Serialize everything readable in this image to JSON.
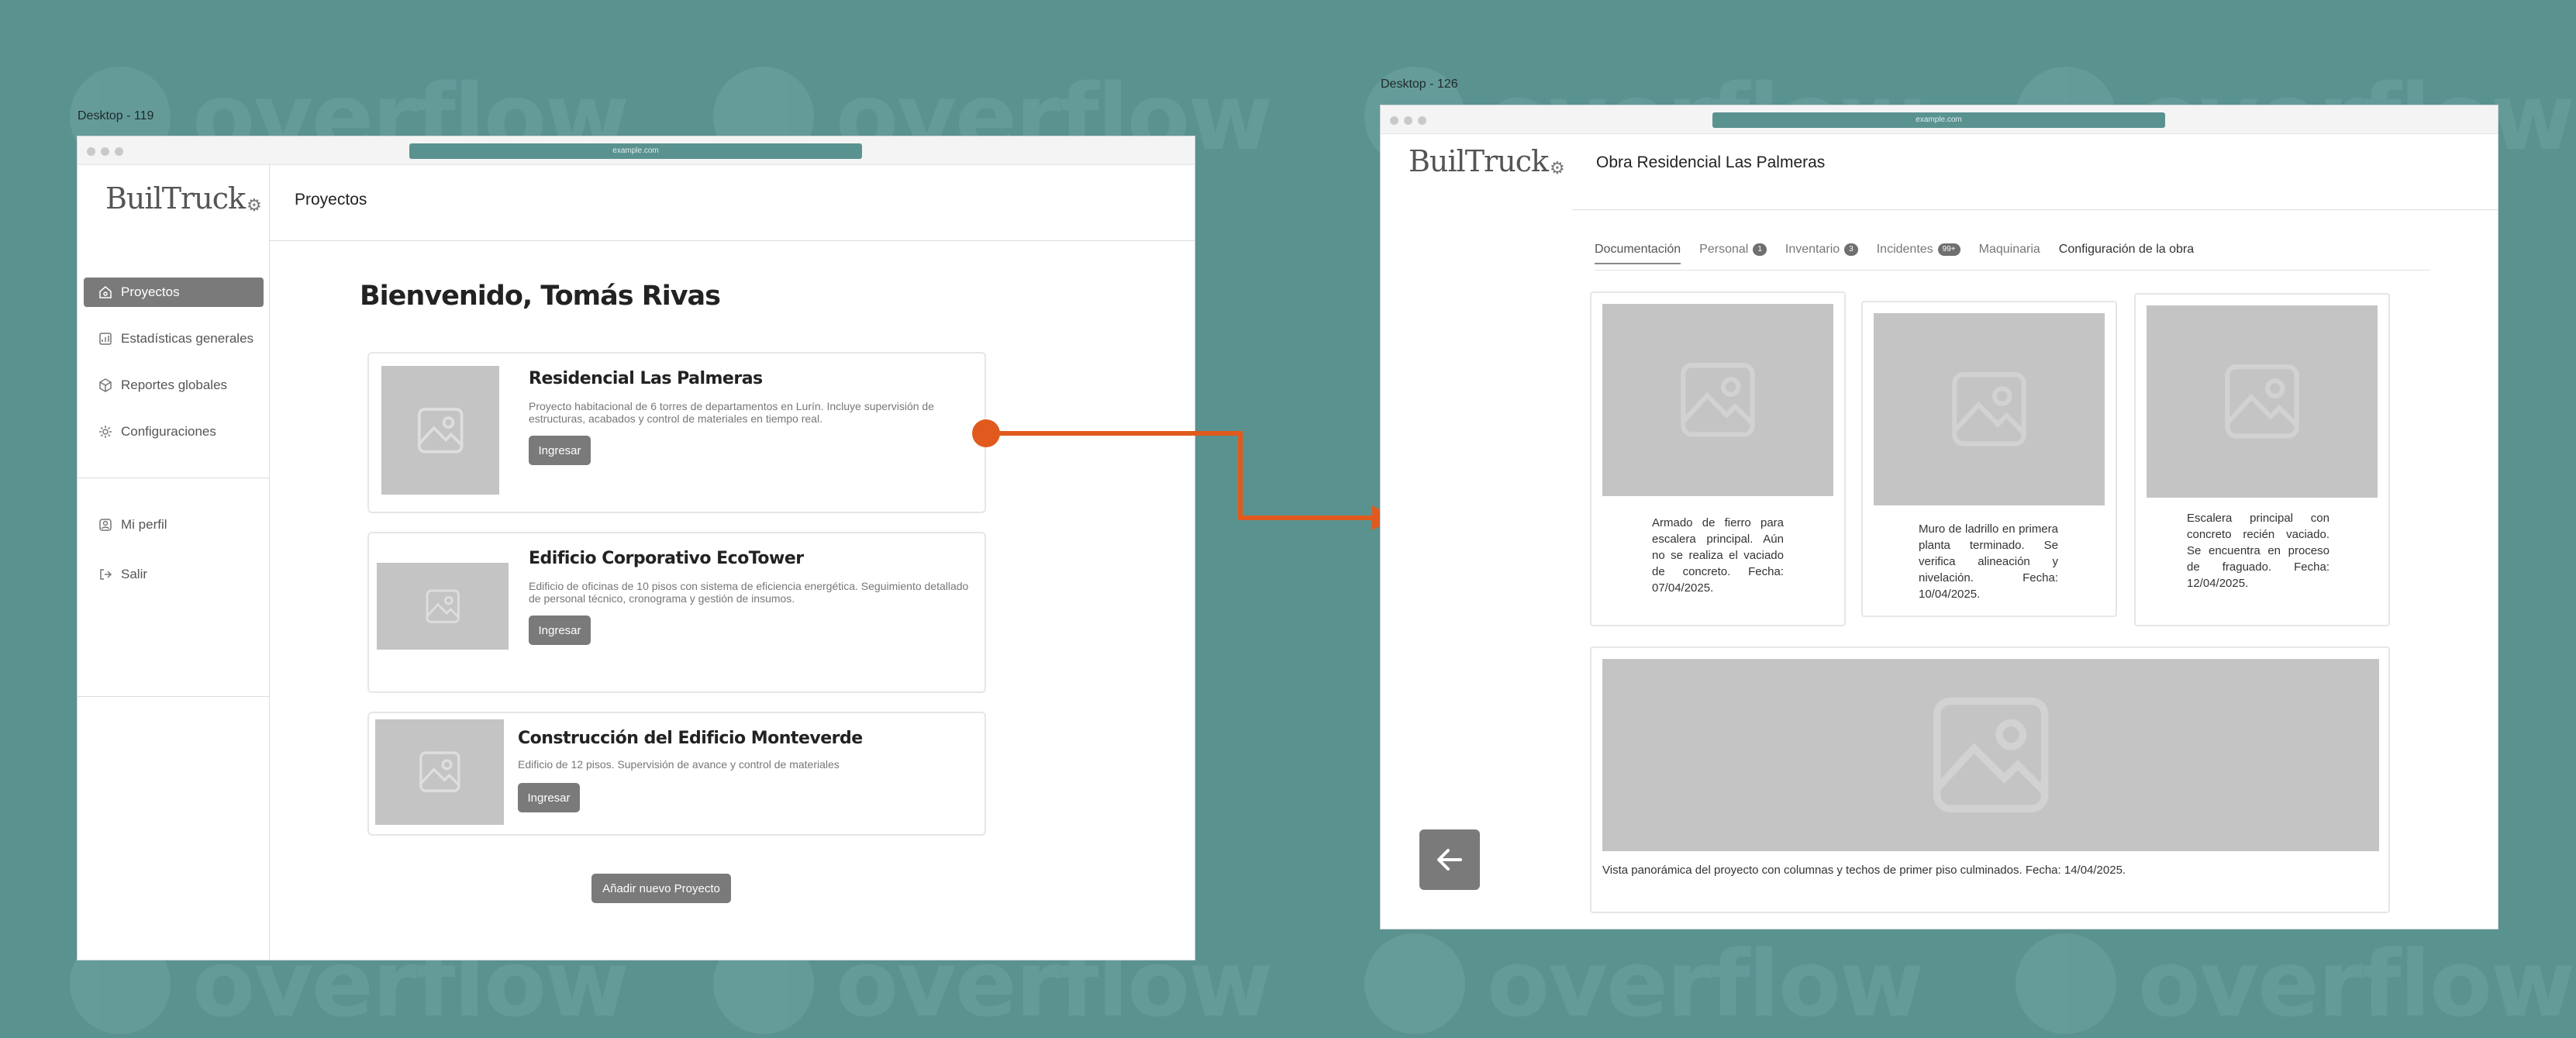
{
  "frames": {
    "left_label": "Desktop - 119",
    "right_label": "Desktop - 126"
  },
  "watermark": "overflow",
  "browser": {
    "url": "example.com"
  },
  "logo": "BuilTruck",
  "sidebar": {
    "items": [
      {
        "label": "Proyectos",
        "icon": "home-icon",
        "active": true
      },
      {
        "label": "Estadísticas generales",
        "icon": "chart-icon"
      },
      {
        "label": "Reportes globales",
        "icon": "box-icon"
      },
      {
        "label": "Configuraciones",
        "icon": "gear-icon"
      }
    ],
    "bottom": [
      {
        "label": "Mi perfil",
        "icon": "user-icon"
      },
      {
        "label": "Salir",
        "icon": "logout-icon"
      }
    ]
  },
  "projects_page": {
    "header_title": "Proyectos",
    "welcome": "Bienvenido, Tomás Rivas",
    "cards": [
      {
        "title": "Residencial Las Palmeras",
        "description": "Proyecto habitacional de 6 torres de departamentos en Lurín. Incluye supervisión de estructuras, acabados y control de materiales en tiempo real.",
        "button": "Ingresar"
      },
      {
        "title": "Edificio Corporativo EcoTower",
        "description": "Edificio de oficinas de 10 pisos con sistema de eficiencia energética. Seguimiento detallado de personal técnico, cronograma y gestión de insumos.",
        "button": "Ingresar"
      },
      {
        "title": "Construcción del Edificio Monteverde",
        "description": "Edificio de 12 pisos. Supervisión de avance y control de materiales",
        "button": "Ingresar"
      }
    ],
    "add_button": "Añadir nuevo Proyecto"
  },
  "project_detail": {
    "title": "Obra Residencial Las Palmeras",
    "tabs": [
      {
        "label": "Documentación",
        "active": true
      },
      {
        "label": "Personal",
        "badge": "1"
      },
      {
        "label": "Inventario",
        "badge": "3"
      },
      {
        "label": "Incidentes",
        "badge": "99+"
      },
      {
        "label": "Maquinaria"
      },
      {
        "label": "Configuración de la obra"
      }
    ],
    "gallery": [
      {
        "caption": "Armado de fierro para escalera principal. Aún no se realiza el vaciado de concreto. Fecha: 07/04/2025."
      },
      {
        "caption": "Muro de ladrillo en primera planta terminado. Se verifica alineación y nivelación. Fecha: 10/04/2025."
      },
      {
        "caption": "Escalera principal con concreto recién vaciado. Se encuentra en proceso de fraguado. Fecha: 12/04/2025."
      },
      {
        "caption": "Vista panorámica del proyecto con columnas y techos de primer piso culminados. Fecha: 14/04/2025."
      }
    ]
  },
  "colors": {
    "background": "#5a9290",
    "button": "#7a7a7a",
    "placeholder": "#c4c4c4",
    "connector": "#e05a1e"
  }
}
